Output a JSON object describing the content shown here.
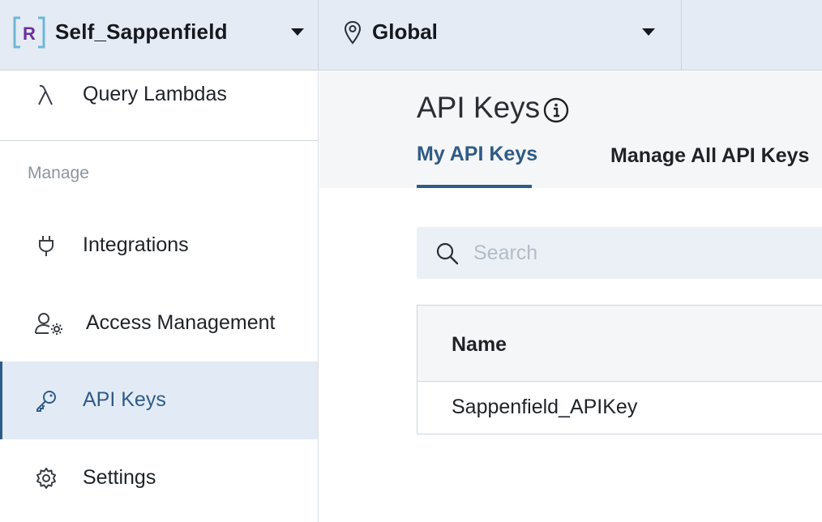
{
  "topbar": {
    "org": {
      "logo_letter": "R",
      "name": "Self_Sappenfield"
    },
    "region": {
      "name": "Global"
    }
  },
  "sidebar": {
    "items": [
      {
        "label": "Query Lambdas",
        "icon": "lambda-icon"
      },
      {
        "label": "Integrations",
        "icon": "plug-icon"
      },
      {
        "label": "Access Management",
        "icon": "user-gear-icon"
      },
      {
        "label": "API Keys",
        "icon": "key-icon",
        "active": true
      },
      {
        "label": "Settings",
        "icon": "gear-icon"
      }
    ],
    "section_label": "Manage"
  },
  "main": {
    "title": "API Keys",
    "tabs": [
      {
        "label": "My API Keys",
        "active": true
      },
      {
        "label": "Manage All API Keys",
        "active": false
      }
    ],
    "search": {
      "placeholder": "Search",
      "value": ""
    },
    "table": {
      "columns": [
        "Name"
      ],
      "rows": [
        [
          "Sappenfield_APIKey"
        ]
      ]
    }
  },
  "colors": {
    "accent": "#2f5b88",
    "topbar_bg": "#e4ebf5",
    "active_nav_bg": "#e2ebf5",
    "logo_purple": "#6b2fa0",
    "logo_bracket": "#6fb7d6"
  }
}
